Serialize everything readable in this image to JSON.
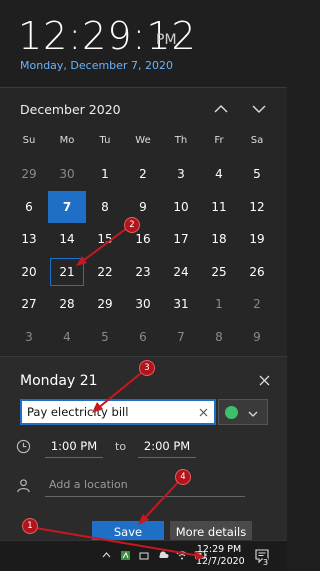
{
  "clock": {
    "time": "12:29:12",
    "ampm": "PM",
    "date": "Monday, December 7, 2020"
  },
  "calendar": {
    "month": "December 2020",
    "weekdays": [
      "Su",
      "Mo",
      "Tu",
      "We",
      "Th",
      "Fr",
      "Sa"
    ],
    "days": [
      {
        "d": "29",
        "other": true
      },
      {
        "d": "30",
        "other": true
      },
      {
        "d": "1"
      },
      {
        "d": "2"
      },
      {
        "d": "3"
      },
      {
        "d": "4"
      },
      {
        "d": "5"
      },
      {
        "d": "6"
      },
      {
        "d": "7",
        "today": true
      },
      {
        "d": "8"
      },
      {
        "d": "9"
      },
      {
        "d": "10"
      },
      {
        "d": "11"
      },
      {
        "d": "12"
      },
      {
        "d": "13"
      },
      {
        "d": "14"
      },
      {
        "d": "15"
      },
      {
        "d": "16"
      },
      {
        "d": "17"
      },
      {
        "d": "18"
      },
      {
        "d": "19"
      },
      {
        "d": "20"
      },
      {
        "d": "21",
        "selected": true
      },
      {
        "d": "22"
      },
      {
        "d": "23"
      },
      {
        "d": "24"
      },
      {
        "d": "25"
      },
      {
        "d": "26"
      },
      {
        "d": "27"
      },
      {
        "d": "28"
      },
      {
        "d": "29"
      },
      {
        "d": "30"
      },
      {
        "d": "31"
      },
      {
        "d": "1",
        "other": true
      },
      {
        "d": "2",
        "other": true
      },
      {
        "d": "3",
        "other": true
      },
      {
        "d": "4",
        "other": true
      },
      {
        "d": "5",
        "other": true
      },
      {
        "d": "6",
        "other": true
      },
      {
        "d": "7",
        "other": true
      },
      {
        "d": "8",
        "other": true
      },
      {
        "d": "9",
        "other": true
      }
    ]
  },
  "event": {
    "day_title": "Monday 21",
    "name_value": "Pay electricity bill",
    "color": "#3ec06a",
    "start_time": "1:00 PM",
    "to_label": "to",
    "end_time": "2:00 PM",
    "location_placeholder": "Add a location",
    "save_label": "Save",
    "more_label": "More details"
  },
  "taskbar": {
    "time": "12:29 PM",
    "date": "12/7/2020",
    "notification_count": "3"
  },
  "annotations": [
    "1",
    "2",
    "3",
    "4"
  ],
  "colors": {
    "accent": "#1e6fc5",
    "link": "#6ab2ff",
    "annotation": "#b0151b"
  }
}
